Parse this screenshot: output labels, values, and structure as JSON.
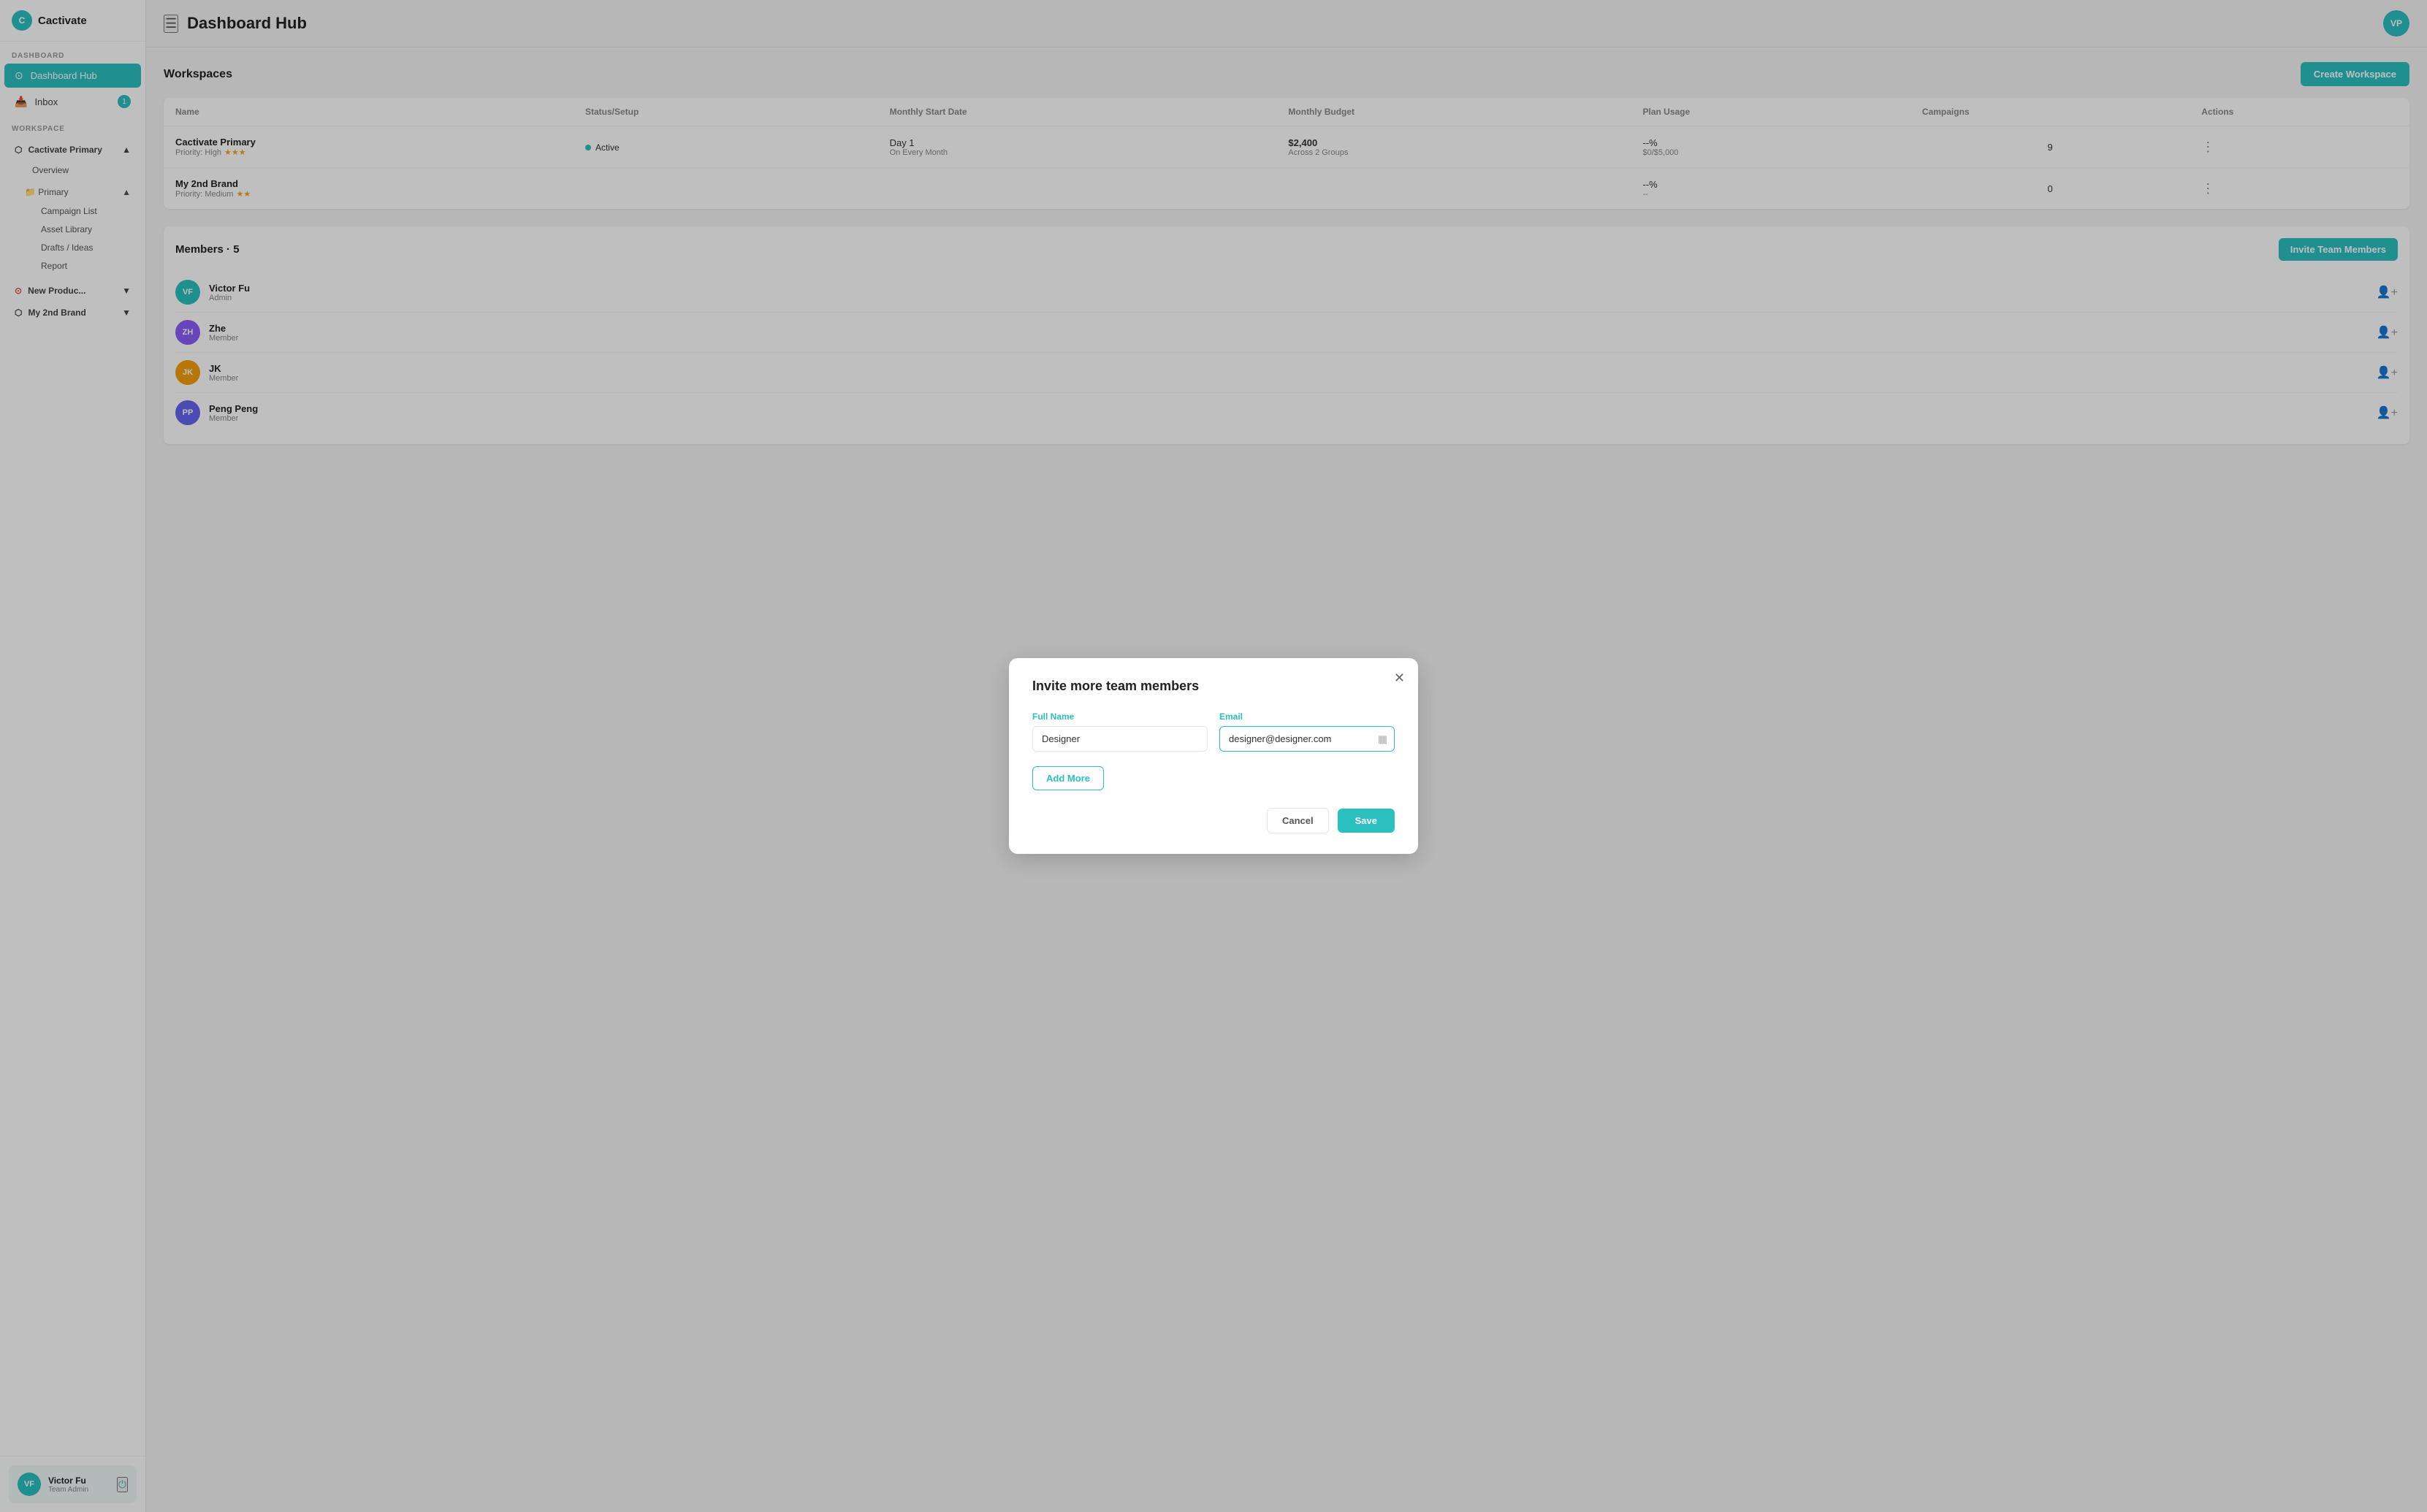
{
  "app": {
    "name": "Cactivate",
    "logo_initials": "C"
  },
  "topbar": {
    "title": "Dashboard Hub",
    "user_initials": "VP"
  },
  "sidebar": {
    "dashboard_label": "DASHBOARD",
    "dashboard_hub": "Dashboard Hub",
    "inbox_label": "Inbox",
    "inbox_badge": "1",
    "workspace_label": "WORKSPACE",
    "workspace_primary_name": "Cactivate Primary",
    "overview_label": "Overview",
    "folder_name": "Primary",
    "campaign_list": "Campaign List",
    "asset_library": "Asset Library",
    "drafts_ideas": "Drafts / Ideas",
    "report": "Report",
    "new_product": "New Produc...",
    "my_2nd_brand": "My 2nd Brand"
  },
  "user": {
    "initials": "VF",
    "name": "Victor Fu",
    "role": "Team Admin"
  },
  "workspaces": {
    "title": "Workspaces",
    "create_btn": "Create Workspace",
    "columns": {
      "name": "Name",
      "status": "Status/Setup",
      "start_date": "Monthly Start Date",
      "budget": "Monthly Budget",
      "plan_usage": "Plan Usage",
      "campaigns": "Campaigns",
      "actions": "Actions"
    },
    "rows": [
      {
        "name": "Cactivate Primary",
        "priority": "Priority: High",
        "stars": "★★★",
        "status": "Active",
        "start_date": "Day 1",
        "start_sub": "On Every Month",
        "budget": "$2,400",
        "budget_sub": "Across 2 Groups",
        "plan_usage": "--%",
        "plan_sub": "$0/$5,000",
        "campaigns": "9"
      },
      {
        "name": "My 2nd Brand",
        "priority": "Priority: Medium",
        "stars": "★★",
        "status": "",
        "start_date": "",
        "start_sub": "",
        "budget": "",
        "budget_sub": "",
        "plan_usage": "--%",
        "plan_sub": "--",
        "campaigns": "0"
      }
    ]
  },
  "members": {
    "title": "Members · 5",
    "invite_btn": "Invite Team Members",
    "rows": [
      {
        "initials": "VF",
        "name": "Victor Fu",
        "role": "Admin",
        "color": "#2bbfbf"
      },
      {
        "initials": "ZH",
        "name": "Zhe",
        "role": "Member",
        "color": "#8b5cf6"
      },
      {
        "initials": "JK",
        "name": "JK",
        "role": "Member",
        "color": "#f59e0b"
      },
      {
        "initials": "PP",
        "name": "Peng Peng",
        "role": "Member",
        "color": "#6366f1"
      }
    ]
  },
  "modal": {
    "title": "Invite more team members",
    "full_name_label": "Full Name",
    "email_label": "Email",
    "full_name_value": "Designer",
    "email_value": "designer@designer.com",
    "add_more_btn": "Add More",
    "cancel_btn": "Cancel",
    "save_btn": "Save"
  }
}
